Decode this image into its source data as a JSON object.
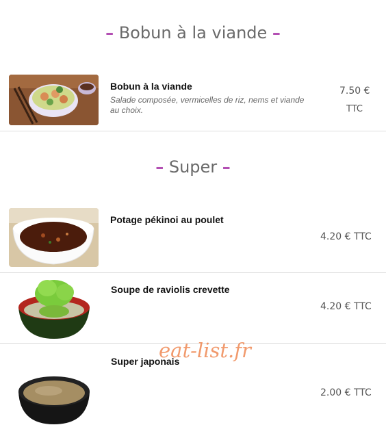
{
  "sections": [
    {
      "title": "Bobun à la viande",
      "dash": "–",
      "items": [
        {
          "name": "Bobun à la viande",
          "description": "Salade composée, vermicelles de riz, nems et viande au choix.",
          "price": "7.50 €",
          "tax": "TTC",
          "image_icon": "bobun-bowl-photo"
        }
      ]
    },
    {
      "title": "Super",
      "dash": "–",
      "items": [
        {
          "name": "Potage pékinoi au poulet",
          "price": "4.20 € TTC",
          "image_icon": "soup-bowl-photo"
        },
        {
          "name": "Soupe de raviolis crevette",
          "price": "4.20 € TTC",
          "image_icon": "dumpling-soup-photo"
        },
        {
          "name": "Super japonais",
          "price": "2.00 € TTC",
          "image_icon": "miso-soup-photo"
        }
      ]
    }
  ],
  "watermark": "eat-list.fr",
  "colors": {
    "accent_dash": "#b34fb3",
    "watermark": "#ec783c",
    "divider": "#dcdcdc"
  }
}
